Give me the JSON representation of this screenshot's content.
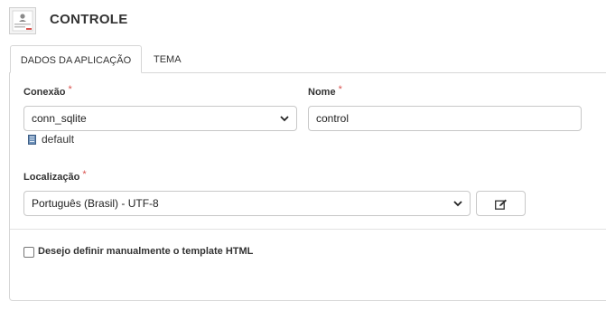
{
  "header": {
    "title": "CONTROLE",
    "icon": "app-document-icon"
  },
  "tabs": [
    {
      "label": "DADOS DA APLICAÇÃO",
      "active": true
    },
    {
      "label": "TEMA",
      "active": false
    }
  ],
  "form": {
    "connection": {
      "label": "Conexão",
      "required_mark": "*",
      "value": "conn_sqlite",
      "db_label": "default",
      "db_icon": "database-icon"
    },
    "name": {
      "label": "Nome",
      "required_mark": "*",
      "value": "control"
    },
    "location": {
      "label": "Localização",
      "required_mark": "*",
      "value": "Português (Brasil) - UTF-8",
      "edit_icon": "edit-icon"
    },
    "manual_template": {
      "label": "Desejo definir manualmente o template HTML",
      "checked": false
    }
  },
  "colors": {
    "required": "#d9534f",
    "border": "#c8c8c8",
    "text": "#333333"
  }
}
